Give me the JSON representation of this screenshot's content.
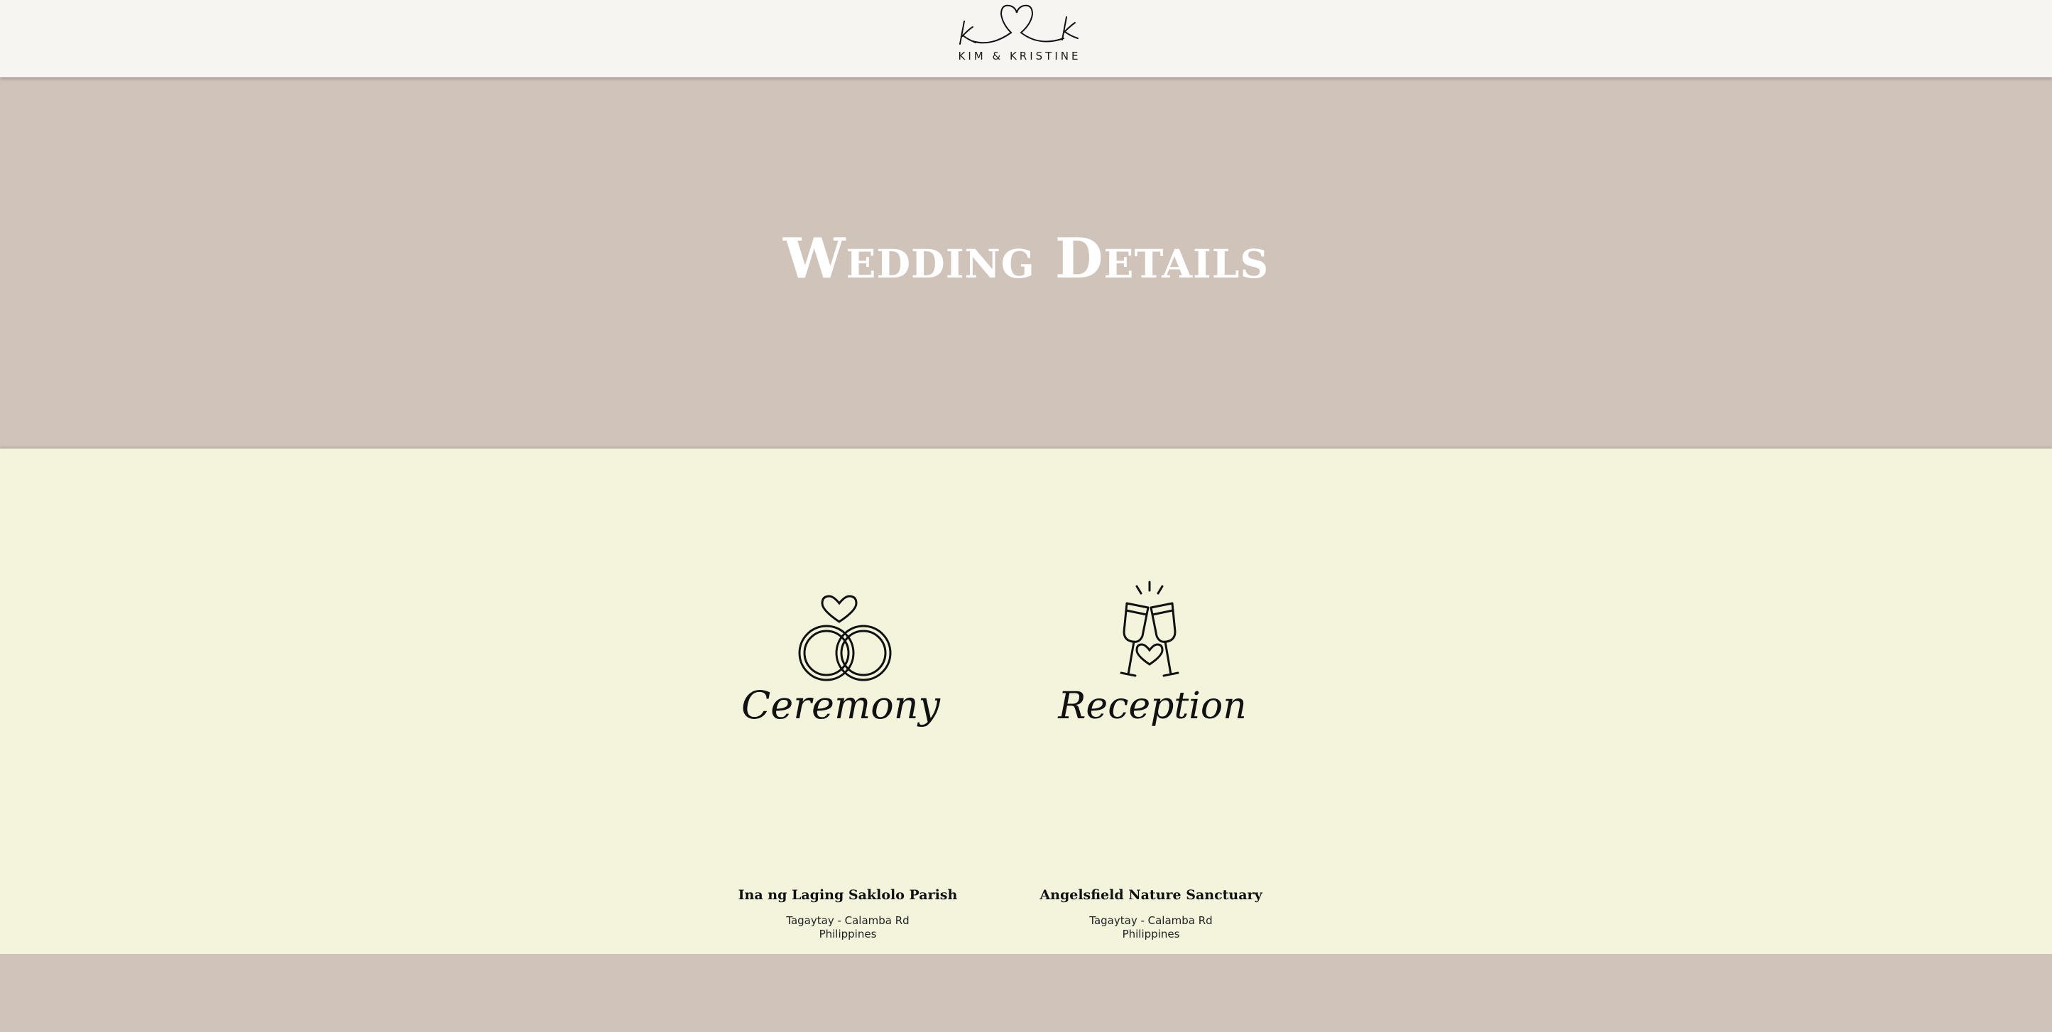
{
  "header": {
    "logo_initials": "k k",
    "logo_text": "KIM & KRISTINE"
  },
  "hero": {
    "title": "Wedding Details"
  },
  "events": [
    {
      "script_title": "Ceremony",
      "icon": "wedding-rings-icon",
      "venue": "Ina ng Laging Saklolo Parish",
      "address_line1": "Tagaytay - Calamba Rd",
      "address_line2": "Philippines"
    },
    {
      "script_title": "Reception",
      "icon": "champagne-toast-icon",
      "venue": "Angelsfield Nature Sanctuary",
      "address_line1": "Tagaytay - Calamba Rd",
      "address_line2": "Philippines"
    }
  ],
  "colors": {
    "header_bg": "#f6f5f1",
    "hero_bg": "#d0c3b9",
    "details_bg": "#f4f3dc",
    "title_text": "#ffffff",
    "ink": "#111111"
  }
}
